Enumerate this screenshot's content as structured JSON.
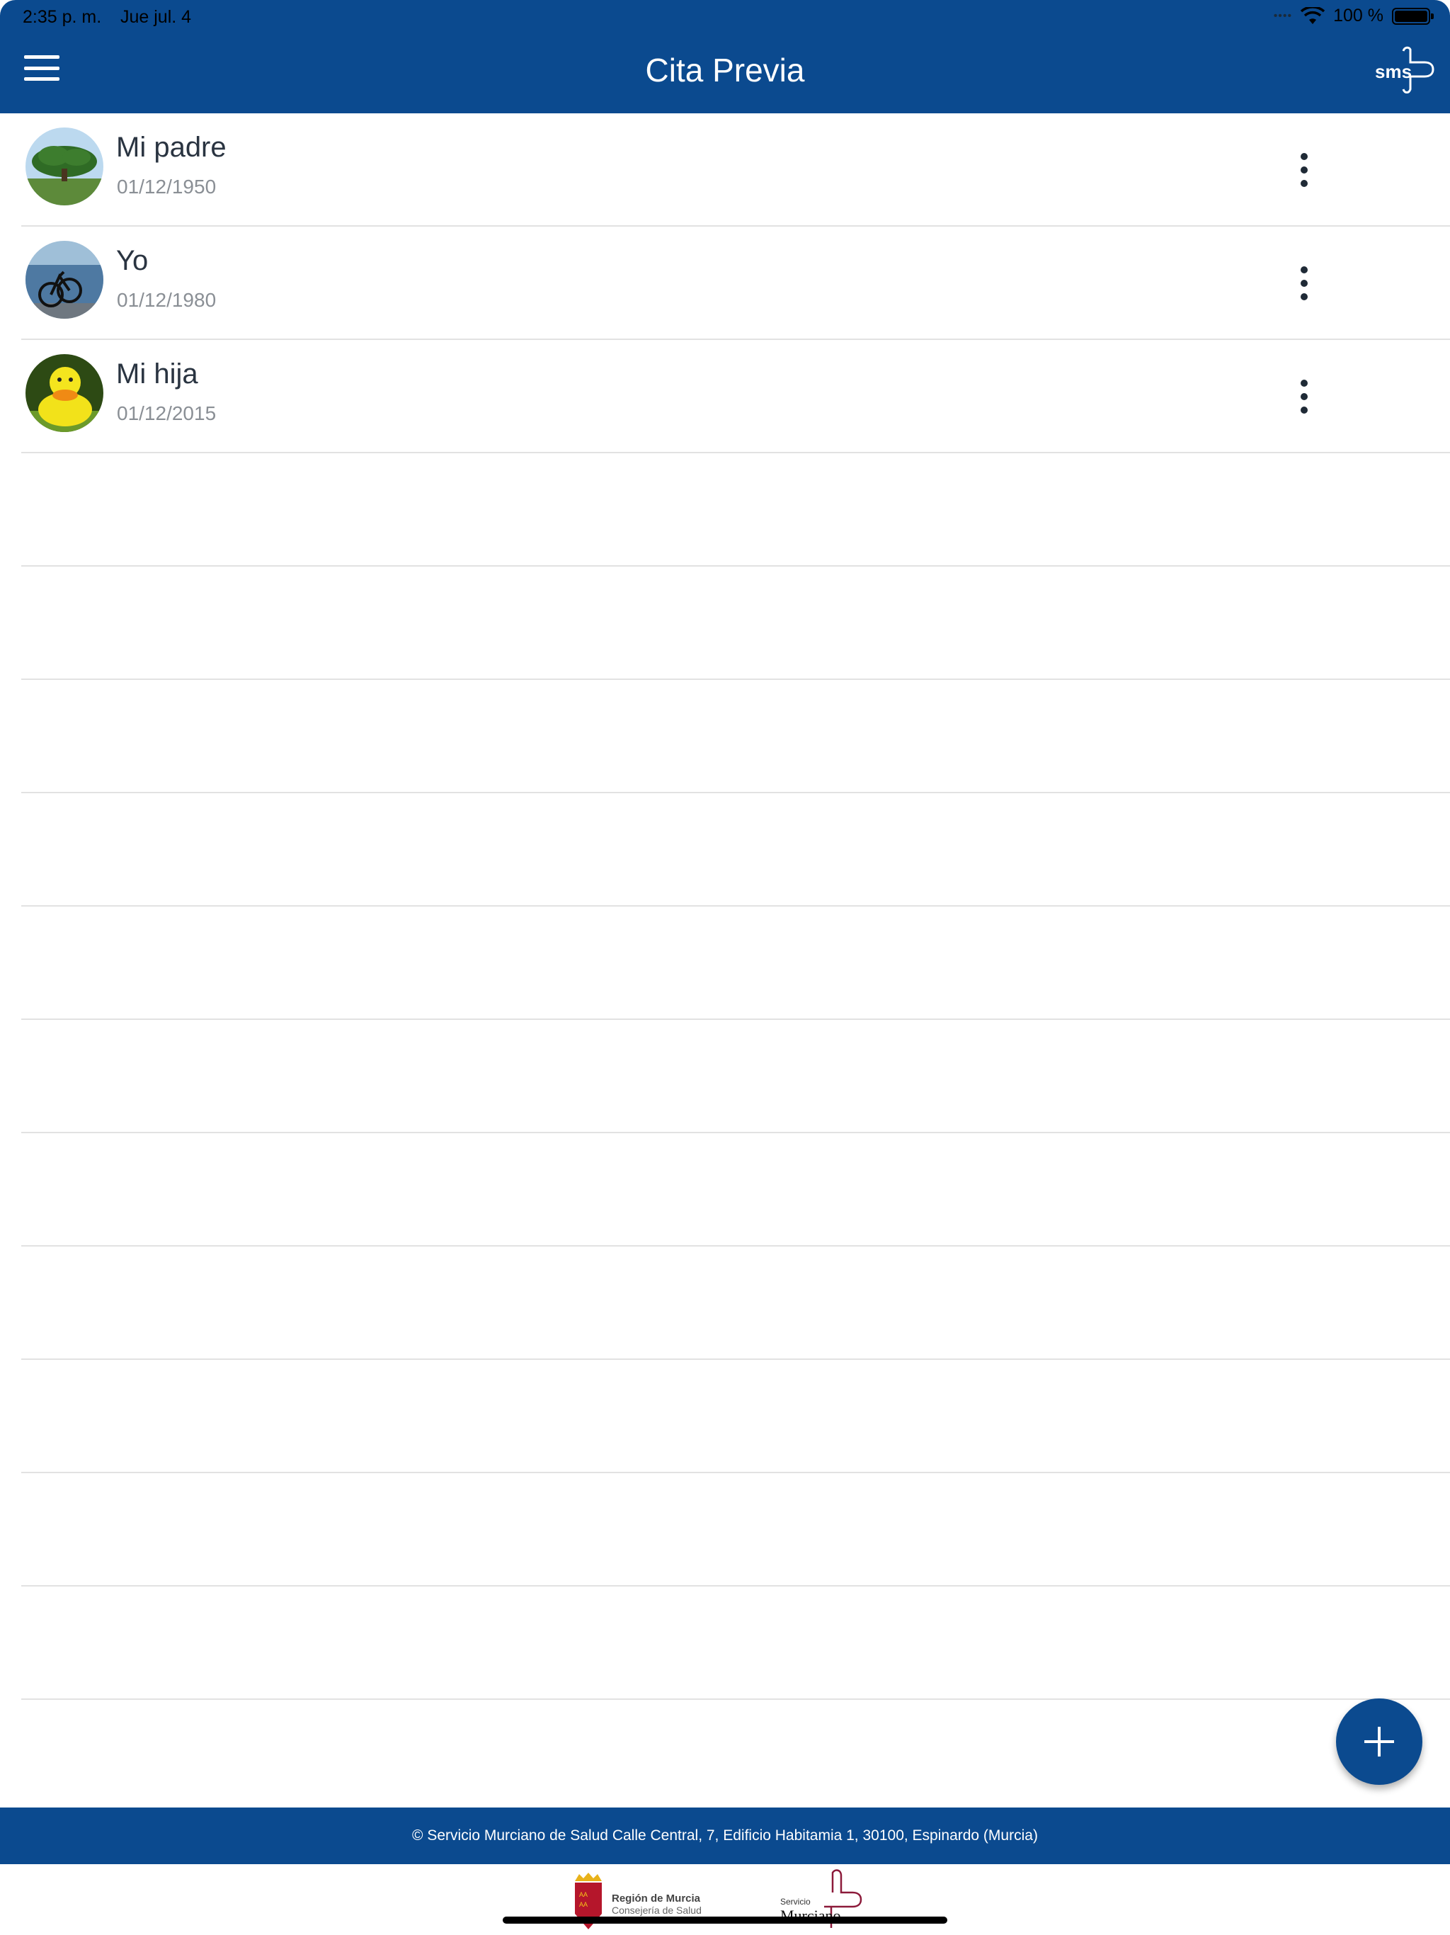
{
  "status_bar": {
    "time": "2:35 p. m.",
    "date": "Jue jul. 4",
    "battery": "100 %"
  },
  "header": {
    "title": "Cita Previa",
    "logo_text": "sms",
    "color": "#0b4a8f"
  },
  "profiles": [
    {
      "name": "Mi padre",
      "date": "01/12/1950",
      "avatar": "tree-photo"
    },
    {
      "name": "Yo",
      "date": "01/12/1980",
      "avatar": "bicycle-photo"
    },
    {
      "name": "Mi hija",
      "date": "01/12/2015",
      "avatar": "rubber-duck-photo"
    }
  ],
  "fab": {
    "icon": "plus-icon"
  },
  "footer": {
    "text": "© Servicio Murciano de Salud Calle Central, 7, Edificio Habitamia 1, 30100, Espinardo (Murcia)",
    "region_logo_line1": "Región de Murcia",
    "region_logo_line2": "Consejería de Salud",
    "sms_logo_line1": "Servicio",
    "sms_logo_line2": "Murciano"
  }
}
